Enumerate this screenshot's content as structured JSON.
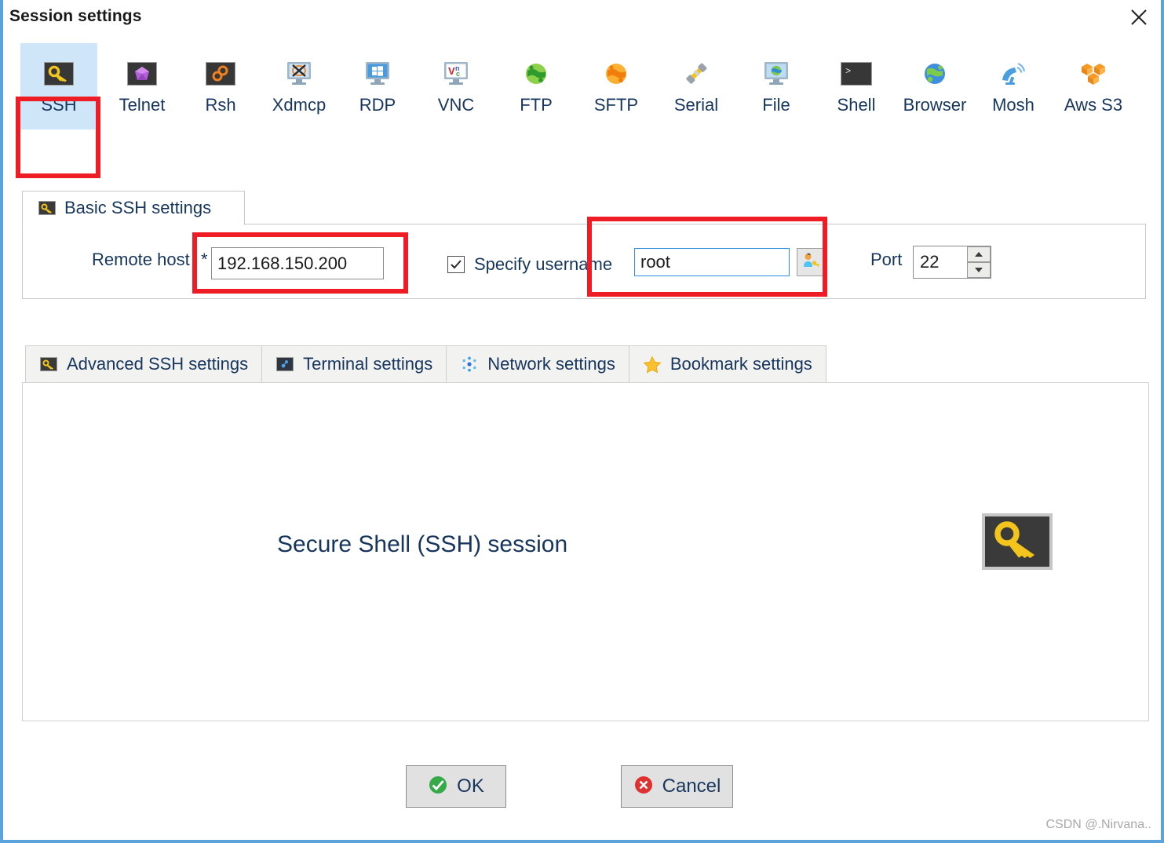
{
  "window": {
    "title": "Session settings",
    "close_icon": "close-icon",
    "border_color": "#5aa3dd"
  },
  "protocols": [
    {
      "label": "SSH",
      "icon": "key-icon",
      "selected": true
    },
    {
      "label": "Telnet",
      "icon": "purple-gem-icon",
      "selected": false
    },
    {
      "label": "Rsh",
      "icon": "orange-gears-icon",
      "selected": false
    },
    {
      "label": "Xdmcp",
      "icon": "monitor-x-icon",
      "selected": false
    },
    {
      "label": "RDP",
      "icon": "monitor-windows-icon",
      "selected": false
    },
    {
      "label": "VNC",
      "icon": "monitor-vnc-icon",
      "selected": false
    },
    {
      "label": "FTP",
      "icon": "green-globe-icon",
      "selected": false
    },
    {
      "label": "SFTP",
      "icon": "orange-globe-icon",
      "selected": false
    },
    {
      "label": "Serial",
      "icon": "plug-connector-icon",
      "selected": false
    },
    {
      "label": "File",
      "icon": "monitor-globe-icon",
      "selected": false
    },
    {
      "label": "Shell",
      "icon": "terminal-icon",
      "selected": false
    },
    {
      "label": "Browser",
      "icon": "blue-globe-icon",
      "selected": false
    },
    {
      "label": "Mosh",
      "icon": "satellite-dish-icon",
      "selected": false
    },
    {
      "label": "Aws S3",
      "icon": "aws-cubes-icon",
      "selected": false
    }
  ],
  "basic_settings": {
    "tab_label": "Basic SSH settings",
    "tab_icon": "key-icon",
    "remote_host_label": "Remote host",
    "required_marker": "*",
    "remote_host_value": "192.168.150.200",
    "specify_username_label": "Specify username",
    "specify_username_checked": true,
    "username_value": "root",
    "username_picker_icon": "user-key-icon",
    "port_label": "Port",
    "port_value": "22",
    "spinner_up_icon": "caret-up-icon",
    "spinner_down_icon": "caret-down-icon"
  },
  "settings_tabs": [
    {
      "label": "Advanced SSH settings",
      "icon": "key-icon"
    },
    {
      "label": "Terminal settings",
      "icon": "terminal-blue-icon"
    },
    {
      "label": "Network settings",
      "icon": "network-dots-icon"
    },
    {
      "label": "Bookmark settings",
      "icon": "star-icon"
    }
  ],
  "panel": {
    "caption": "Secure Shell (SSH) session",
    "icon": "key-icon"
  },
  "footer": {
    "ok_label": "OK",
    "ok_icon": "green-check-icon",
    "cancel_label": "Cancel",
    "cancel_icon": "red-x-icon"
  },
  "watermark": "CSDN @.Nirvana..",
  "colors": {
    "accent_blue": "#17365d",
    "highlight_red": "#ee1c24",
    "selected_tab_bg": "#cfe5f8",
    "focus_border": "#2f8fe0"
  }
}
